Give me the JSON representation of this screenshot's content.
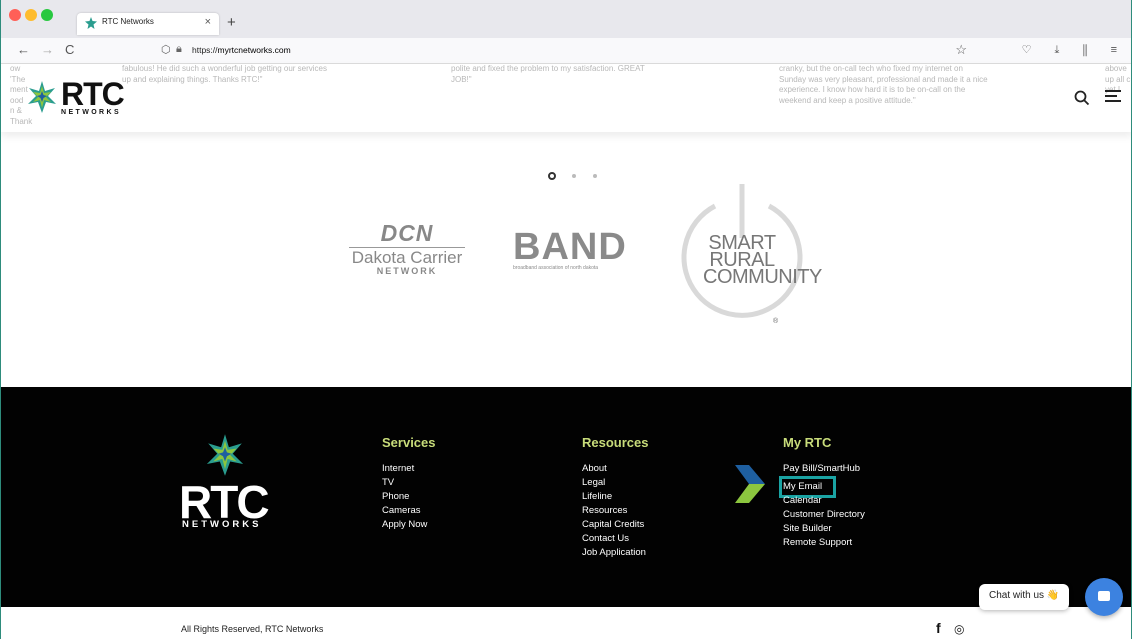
{
  "browser": {
    "tab_title": "RTC Networks",
    "tab_close": "×",
    "new_tab": "+",
    "back": "←",
    "forward": "→",
    "reload": "C",
    "url_prefix": "https://",
    "url_host": "myrtcnetworks.com",
    "bookmark_star": "☆",
    "toolbar_icons": "♡ ⤓ ⫼ ≡"
  },
  "testimonials": {
    "left_edge": "ow\n'The\nment\nood\nn &\nThank",
    "t1": "fabulous! He did such a wonderful job getting our services\nup and explaining things. Thanks RTC!\"",
    "t2": "polite and fixed the problem to my satisfaction. GREAT\nJOB!\"",
    "t3": "cranky, but the on-call tech who fixed my internet on\nSunday was very pleasant, professional and made it a nice\nexperience. I know how hard it is to be on-call on the\nweekend and keep a positive attitude.\"",
    "right_edge": "above\nup all c\nyet I"
  },
  "header": {
    "logo_word": "RTC",
    "logo_sub": "NETWORKS",
    "search_icon": "search-icon",
    "menu_icon": "hamburger-icon"
  },
  "slider": {
    "pages": 3,
    "active": 1
  },
  "partners": {
    "dcn_top": "DCN",
    "dcn_mid": "Dakota Carrier",
    "dcn_bot": "NETWORK",
    "band_word": "BAND",
    "band_sub": "broadband association of north dakota",
    "src_text": "SMART RURAL COMMUNITY",
    "src_reg": "®"
  },
  "footer": {
    "logo_word": "RTC",
    "logo_sub": "NETWORKS",
    "services": {
      "heading": "Services",
      "links": [
        "Internet",
        "TV",
        "Phone",
        "Cameras",
        "Apply Now"
      ]
    },
    "resources": {
      "heading": "Resources",
      "links": [
        "About",
        "Legal",
        "Lifeline",
        "Resources",
        "Capital Credits",
        "Contact Us",
        "Job Application"
      ]
    },
    "myrtc": {
      "heading": "My RTC",
      "links": [
        "Pay Bill/SmartHub",
        "My Email",
        "Calendar",
        "Customer Directory",
        "Site Builder",
        "Remote Support"
      ]
    },
    "heading_color": "#c8dc7a",
    "highlight_color": "#1aa3a3"
  },
  "bottom": {
    "copyright": "All Rights Reserved, RTC Networks",
    "facebook": "f",
    "instagram": "◎"
  },
  "chat": {
    "label": "Chat with us 👋",
    "button_color": "#3c82e0"
  }
}
